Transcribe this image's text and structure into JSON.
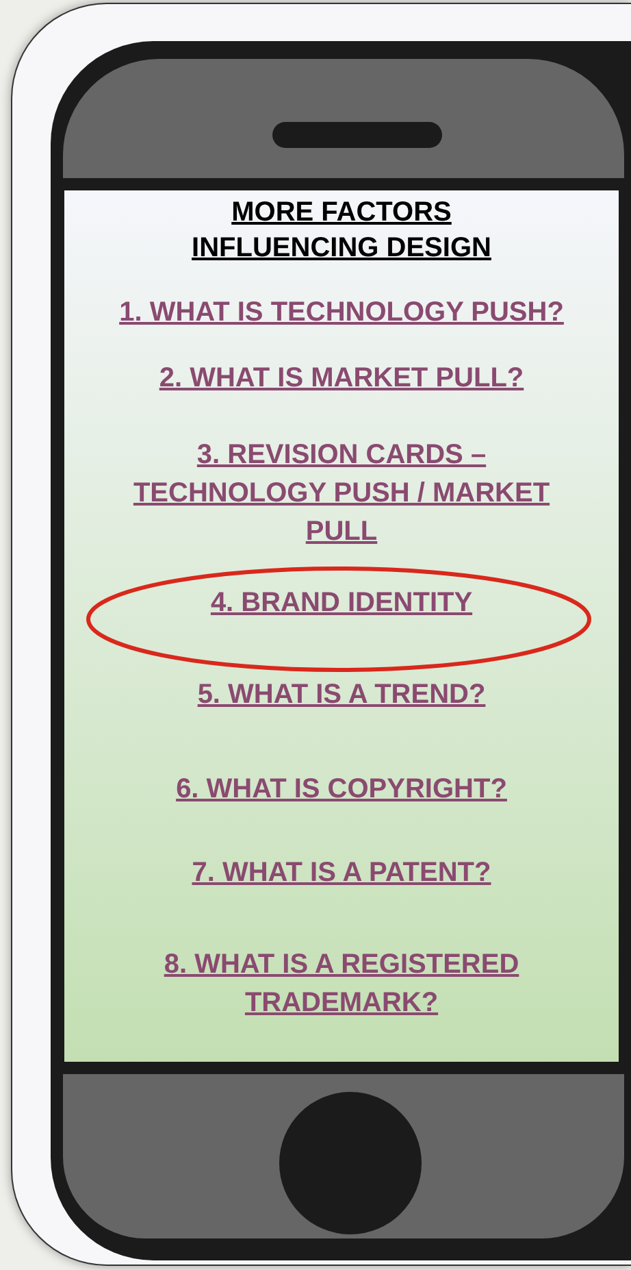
{
  "screen": {
    "title_lines": [
      "MORE FACTORS",
      "INFLUENCING DESIGN"
    ],
    "links": [
      {
        "lines": [
          "1. WHAT IS TECHNOLOGY PUSH?"
        ],
        "circled": false
      },
      {
        "lines": [
          "2. WHAT IS MARKET PULL?"
        ],
        "circled": false
      },
      {
        "lines": [
          "3. REVISION CARDS –",
          "TECHNOLOGY PUSH / MARKET",
          "PULL"
        ],
        "circled": false
      },
      {
        "lines": [
          "4. BRAND IDENTITY"
        ],
        "circled": true
      },
      {
        "lines": [
          "5. WHAT IS A TREND?"
        ],
        "circled": false
      },
      {
        "lines": [
          "6. WHAT IS COPYRIGHT?"
        ],
        "circled": false
      },
      {
        "lines": [
          "7. WHAT IS A PATENT?"
        ],
        "circled": false
      },
      {
        "lines": [
          "8. WHAT IS A REGISTERED",
          "TRADEMARK?"
        ],
        "circled": false
      }
    ]
  }
}
